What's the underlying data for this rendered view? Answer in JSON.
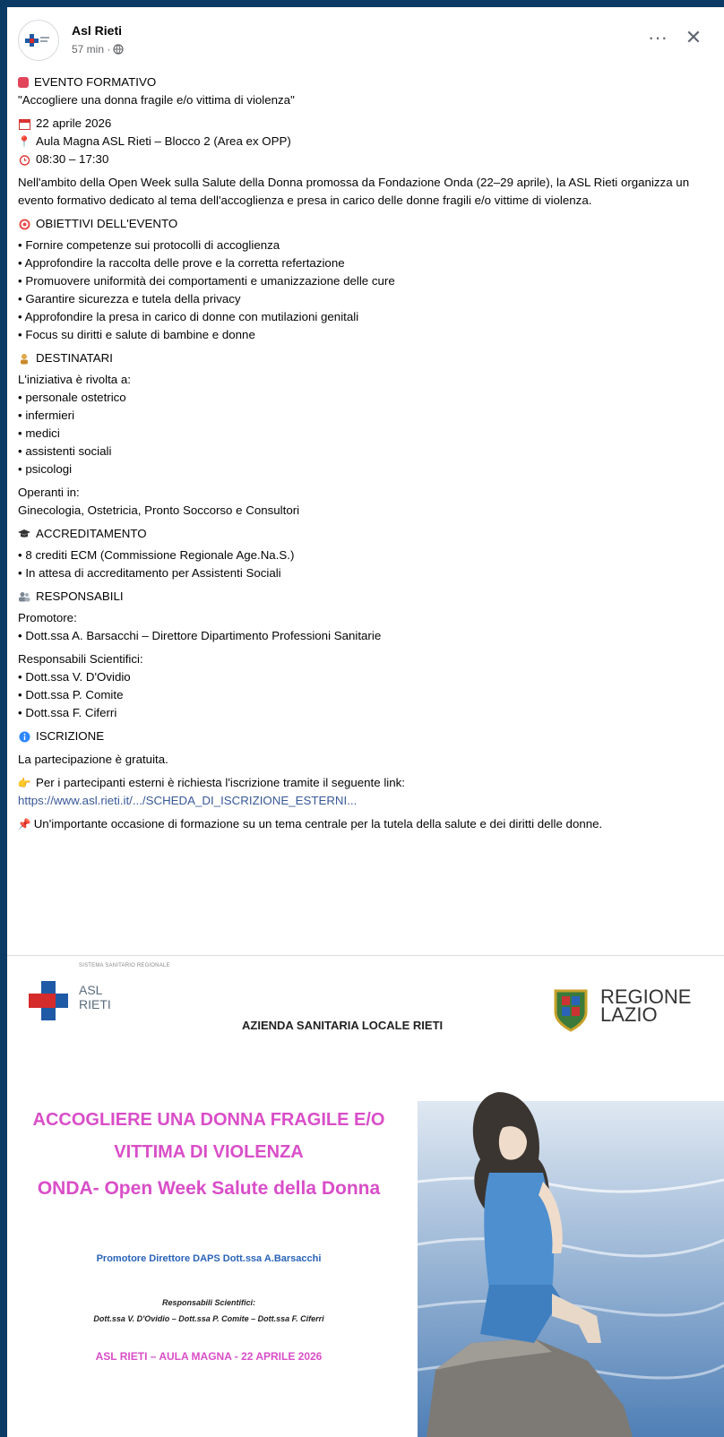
{
  "post": {
    "author": "Asl Rieti",
    "time": "57 min ·",
    "more_icon": "more-horizontal-icon",
    "close_icon": "close-icon"
  },
  "content": {
    "event_heading": "EVENTO FORMATIVO",
    "event_title": "\"Accogliere una donna fragile e/o vittima di violenza\"",
    "date": "22 aprile 2026",
    "place": "Aula Magna ASL Rieti – Blocco 2 (Area ex OPP)",
    "hours": "08:30 – 17:30",
    "intro": "Nell'ambito della Open Week sulla Salute della Donna promossa da Fondazione Onda (22–29 aprile), la ASL Rieti organizza un evento formativo dedicato al tema dell'accoglienza e presa in carico delle donne fragili e/o vittime di violenza.",
    "objectives_heading": "OBIETTIVI DELL'EVENTO",
    "objectives": [
      "• Fornire competenze sui protocolli di accoglienza",
      "• Approfondire la raccolta delle prove e la corretta refertazione",
      "• Promuovere uniformità dei comportamenti e umanizzazione delle cure",
      "• Garantire sicurezza e tutela della privacy",
      "• Approfondire la presa in carico di donne con mutilazioni genitali",
      "• Focus su diritti e salute di bambine e donne"
    ],
    "recipients_heading": "DESTINATARI",
    "recipients_intro": "L'iniziativa è rivolta a:",
    "recipients": [
      "• personale ostetrico",
      "• infermieri",
      "• medici",
      "• assistenti sociali",
      "• psicologi"
    ],
    "operating_label": "Operanti in:",
    "operating_value": "Ginecologia, Ostetricia, Pronto Soccorso e Consultori",
    "accreditation_heading": "ACCREDITAMENTO",
    "accreditation": [
      "• 8 crediti ECM (Commissione Regionale Age.Na.S.)",
      "• In attesa di accreditamento per Assistenti Sociali"
    ],
    "responsible_heading": "RESPONSABILI",
    "promoter_label": "Promotore:",
    "promoter": "• Dott.ssa A. Barsacchi – Direttore Dipartimento Professioni Sanitarie",
    "scientific_label": "Responsabili Scientifici:",
    "scientific": [
      "• Dott.ssa V. D'Ovidio",
      "• Dott.ssa P. Comite",
      "• Dott.ssa F. Ciferri"
    ],
    "registration_heading": "ISCRIZIONE",
    "free_text": "La partecipazione è gratuita.",
    "external_text": "Per i partecipanti esterni è richiesta l'iscrizione tramite il seguente link:",
    "link": "https://www.asl.rieti.it/.../SCHEDA_DI_ISCRIZIONE_ESTERNI...",
    "closing": "Un'importante occasione di formazione su un tema centrale per la tutela della salute e dei diritti delle donne."
  },
  "poster": {
    "ssr_label": "SISTEMA SANITARIO REGIONALE",
    "asl_line1": "ASL",
    "asl_line2": "RIETI",
    "azienda": "AZIENDA SANITARIA LOCALE RIETI",
    "regione_line1": "REGIONE",
    "regione_line2": "LAZIO",
    "title1": "ACCOGLIERE UNA DONNA FRAGILE E/O",
    "title2": "VITTIMA DI VIOLENZA",
    "title3": "ONDA- Open Week Salute della Donna",
    "promoter": "Promotore Direttore DAPS Dott.ssa A.Barsacchi",
    "resp_label": "Responsabili Scientifici:",
    "resp_names": "Dott.ssa V. D'Ovidio – Dott.ssa P. Comite – Dott.ssa F. Ciferri",
    "venue": "ASL RIETI – AULA MAGNA - 22 APRILE 2026"
  },
  "colors": {
    "accent_pink": "#d94ec8",
    "accent_blue": "#2a63b8",
    "link": "#385898",
    "frame": "#0b3a64"
  }
}
